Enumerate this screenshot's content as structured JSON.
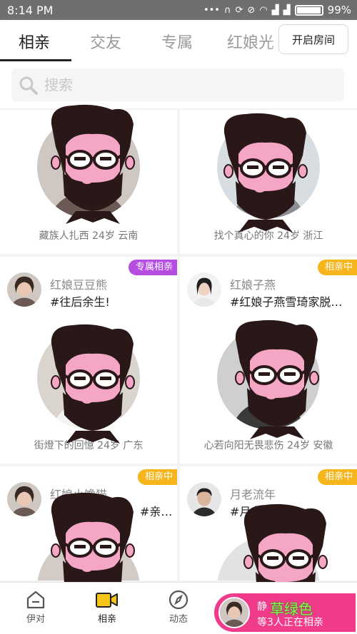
{
  "status_bar": {
    "time": "8:14 PM",
    "battery": "99%",
    "icons": [
      "dots-icon",
      "headset-icon",
      "sync-icon",
      "mute-icon",
      "wifi-icon",
      "signal-icon",
      "signal-icon",
      "battery-icon"
    ]
  },
  "tabs": [
    {
      "label": "相亲",
      "active": true
    },
    {
      "label": "交友",
      "active": false
    },
    {
      "label": "专属",
      "active": false
    },
    {
      "label": "红娘光",
      "active": false
    }
  ],
  "open_room_button": "开启房间",
  "search": {
    "placeholder": "搜索",
    "value": ""
  },
  "cards": [
    {
      "caption": "藏族人扎西 24岁 云南"
    },
    {
      "caption": "找个真心的你 24岁 浙江"
    },
    {
      "matchmaker": "红娘豆豆熊",
      "topic": "#往后余生!",
      "badge": "专属相亲",
      "badge_color": "#b44de0",
      "caption": "街燈下的回憶 24岁 广东"
    },
    {
      "matchmaker": "红娘子燕",
      "topic": "#红娘子燕雪琦家脱单...",
      "badge": "相亲中",
      "badge_color": "#f5b51b",
      "caption": "心若向阳无畏悲伤 24岁 安徽"
    },
    {
      "matchmaker": "红娘小馋猫",
      "topic": "#亲群!",
      "badge": "相亲中",
      "badge_color": "#f5b51b"
    },
    {
      "matchmaker": "月老流年",
      "topic": "#月老交友相...",
      "badge": "相亲中",
      "badge_color": "#f5b51b"
    }
  ],
  "bottom_nav": [
    {
      "label": "伊对",
      "icon": "home-icon"
    },
    {
      "label": "相亲",
      "icon": "video-icon"
    },
    {
      "label": "动态",
      "icon": "compass-icon"
    }
  ],
  "live_banner": {
    "name": "静",
    "count_text": "等3人正在相亲"
  },
  "watermark": "草绿色",
  "colors": {
    "accent_pink": "#f03b8b",
    "badge_purple": "#b44de0",
    "badge_orange": "#f5b51b",
    "video_yellow": "#f5c518"
  }
}
